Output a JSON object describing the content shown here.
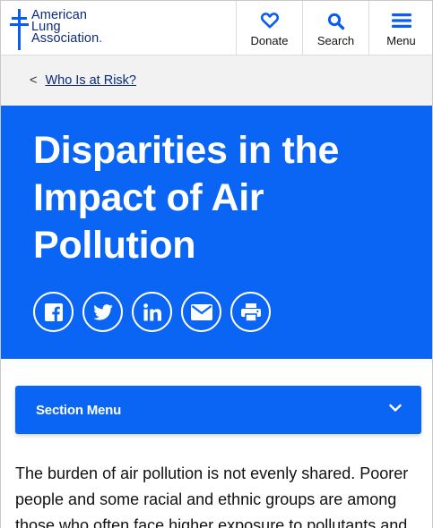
{
  "header": {
    "logo": {
      "line1": "American",
      "line2": "Lung",
      "line3": "Association",
      "dot": ".",
      "icon": "lorraine-cross-icon"
    },
    "nav": [
      {
        "label": "Donate",
        "icon": "heart-icon"
      },
      {
        "label": "Search",
        "icon": "search-icon"
      },
      {
        "label": "Menu",
        "icon": "hamburger-icon"
      }
    ]
  },
  "breadcrumb": {
    "separator": "<",
    "label": "Who Is at Risk?"
  },
  "hero": {
    "title": "Disparities in the Impact of Air Pollution",
    "share": [
      {
        "icon": "facebook-icon"
      },
      {
        "icon": "twitter-icon"
      },
      {
        "icon": "linkedin-icon"
      },
      {
        "icon": "email-icon"
      },
      {
        "icon": "print-icon"
      }
    ]
  },
  "section_menu": {
    "label": "Section Menu",
    "icon": "chevron-down-icon"
  },
  "content": {
    "intro": "The burden of air pollution is not evenly shared. Poorer people and some racial and ethnic groups are among those who often face higher exposure to pollutants and"
  },
  "colors": {
    "brand_blue": "#0a64f4",
    "navy": "#0b2a7a",
    "breadcrumb_bg": "#f2f2f2"
  }
}
